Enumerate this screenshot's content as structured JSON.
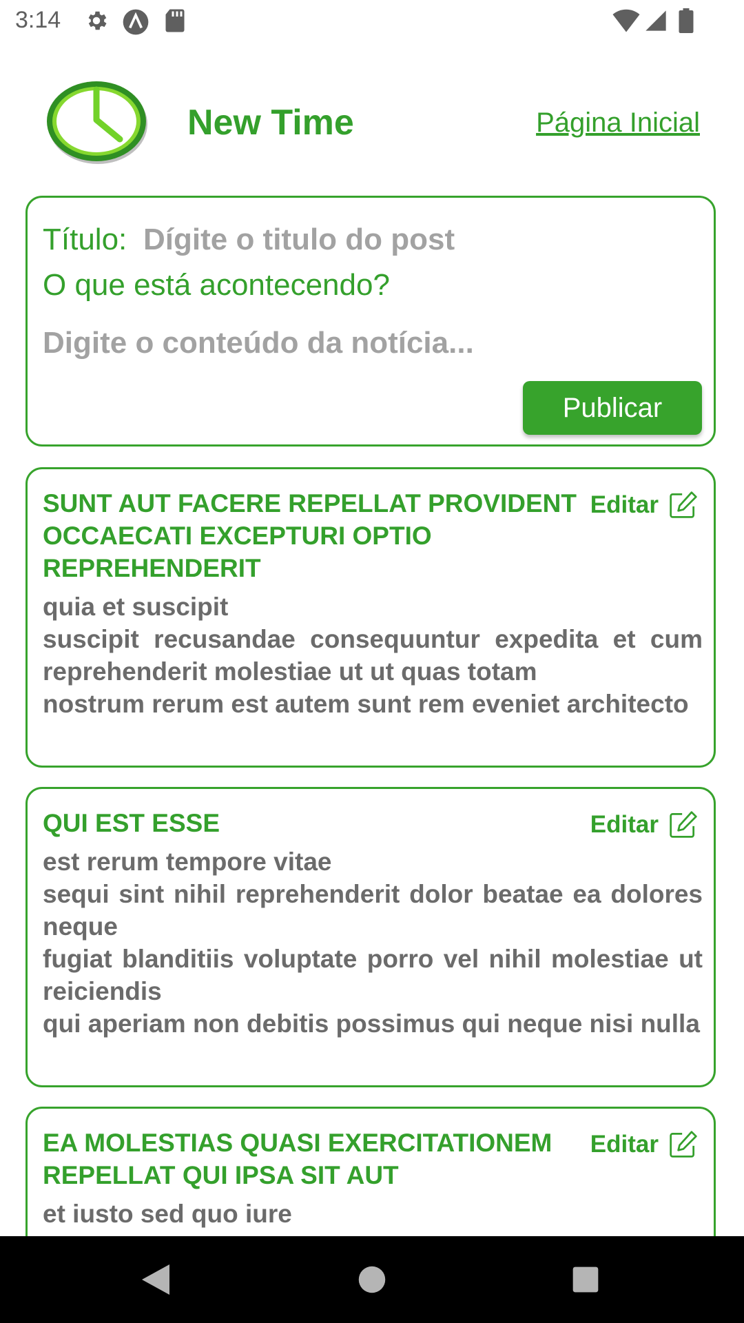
{
  "status_bar": {
    "time": "3:14",
    "left_icons": [
      "gear-icon",
      "a-circle-icon",
      "sd-card-icon"
    ],
    "right_icons": [
      "wifi-icon",
      "signal-icon",
      "battery-icon"
    ]
  },
  "header": {
    "logo_icon": "clock-icon",
    "title": "New Time",
    "home_link": "Página Inicial"
  },
  "compose": {
    "title_label": "Título:",
    "title_placeholder": "Dígite o titulo do post",
    "prompt": "O que está acontecendo?",
    "content_placeholder": "Digite o conteúdo da notícia...",
    "publish_label": "Publicar"
  },
  "posts": [
    {
      "title": "SUNT AUT FACERE REPELLAT PROVIDENT OCCAECATI EXCEPTURI OPTIO REPREHENDERIT",
      "body": "quia et suscipit\nsuscipit recusandae consequuntur expedita et cum reprehenderit molestiae ut ut quas totam\nnostrum rerum est autem sunt rem eveniet architecto",
      "edit_label": "Editar"
    },
    {
      "title": "QUI EST ESSE",
      "body": "est rerum tempore vitae\nsequi sint nihil reprehenderit dolor beatae ea dolores neque\nfugiat blanditiis voluptate porro vel nihil molestiae ut reiciendis\nqui aperiam non debitis possimus qui neque nisi nulla",
      "edit_label": "Editar"
    },
    {
      "title": "EA MOLESTIAS QUASI EXERCITATIONEM REPELLAT QUI IPSA SIT AUT",
      "body": "et iusto sed quo iure\nvoluptatem occaecati omnis eligendi aut ad",
      "edit_label": "Editar"
    }
  ],
  "colors": {
    "accent": "#34a02c",
    "border": "#37a32c",
    "body_text": "#6b6b6b",
    "placeholder": "#a2a2a2"
  },
  "nav_bar": {
    "icons": [
      "back-triangle-icon",
      "home-circle-icon",
      "recents-square-icon"
    ]
  }
}
